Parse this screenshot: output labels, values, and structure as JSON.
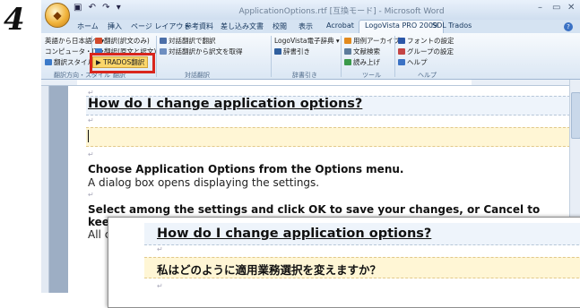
{
  "step_number": "4",
  "window": {
    "title": "ApplicationOptions.rtf [互換モード] - Microsoft Word",
    "qat": "▣ ↶ ↷ ▾",
    "controls": {
      "minimize": "–",
      "maximize": "▭",
      "close": "✕"
    }
  },
  "tabs": [
    {
      "label": "ホーム"
    },
    {
      "label": "挿入"
    },
    {
      "label": "ページ レイアウト"
    },
    {
      "label": "参考資料"
    },
    {
      "label": "差し込み文書"
    },
    {
      "label": "校閲"
    },
    {
      "label": "表示"
    },
    {
      "label": "Acrobat"
    },
    {
      "label": "LogoVista PRO 2009"
    },
    {
      "label": "SDL Trados"
    }
  ],
  "ribbon": {
    "group1": {
      "items": [
        "英語から日本語へ ▾",
        "コンピュータ・IT ▾",
        "翻訳スタイルマネージャー"
      ],
      "label": "翻訳方向・スタイル"
    },
    "group2": {
      "items": [
        "翻訳(訳文のみ)",
        "翻訳(原文と訳文)",
        "TRADOS翻訳"
      ],
      "label": "翻訳"
    },
    "group3": {
      "items": [
        "対話翻訳で翻訳",
        "対話翻訳から訳文を取得"
      ],
      "label": "対話翻訳"
    },
    "group4": {
      "items": [
        "LogoVista電子辞典 ▾",
        "辞書引き"
      ],
      "label": "辞書引き"
    },
    "group5": {
      "items": [
        "用例アーカイブ",
        "文献検索",
        "読み上げ"
      ],
      "label": "ツール"
    },
    "group6": {
      "items": [
        "フォントの設定",
        "グループの設定",
        "ヘルプ"
      ],
      "label": "ヘルプ"
    }
  },
  "document": {
    "heading": "How do I change application options?",
    "para_mark": "↵",
    "line1": "Choose Application Options from the Options menu.",
    "line2": "A dialog box opens displaying the settings.",
    "line3": "Select among the settings and click OK to save your changes, or Cancel to",
    "line4": "keep",
    "line5": "All cl"
  },
  "overlay": {
    "heading": "How do I change application options?",
    "japanese": "私はどのように適用業務選択を変えますか？",
    "para_mark": "↵"
  }
}
